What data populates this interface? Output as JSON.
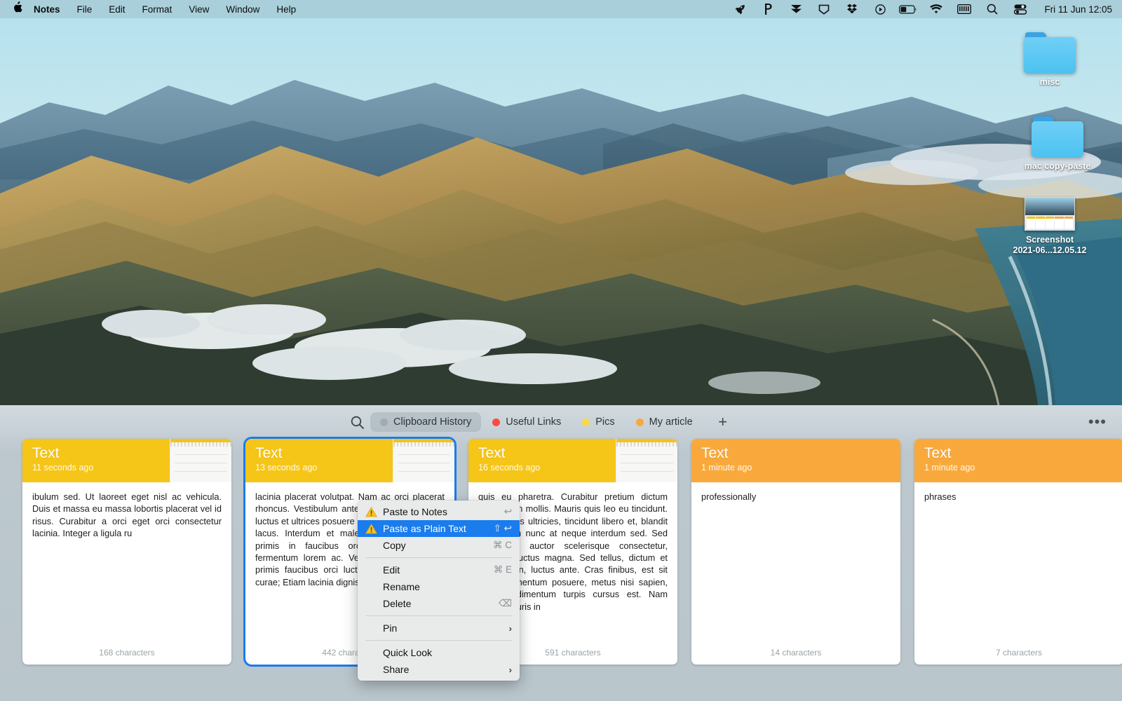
{
  "menubar": {
    "apple_glyph": "&#63743;",
    "items": [
      {
        "label": "Notes",
        "bold": true
      },
      {
        "label": "File",
        "bold": false
      },
      {
        "label": "Edit",
        "bold": false
      },
      {
        "label": "Format",
        "bold": false
      },
      {
        "label": "View",
        "bold": false
      },
      {
        "label": "Window",
        "bold": false
      },
      {
        "label": "Help",
        "bold": false
      }
    ],
    "status_icons": [
      {
        "name": "rocket-icon",
        "glyph": "Ὠ0"
      },
      {
        "name": "pocket-icon",
        "glyph": "P"
      },
      {
        "name": "chevron-stack-icon",
        "glyph": "⮟"
      },
      {
        "name": "tag-icon",
        "glyph": "⬟"
      },
      {
        "name": "dropbox-icon",
        "glyph": "❖"
      },
      {
        "name": "play-circle-icon",
        "glyph": "▶"
      },
      {
        "name": "battery-icon",
        "glyph": "battery"
      },
      {
        "name": "wifi-icon",
        "glyph": "◠"
      },
      {
        "name": "keyboard-icon",
        "glyph": "⌸"
      },
      {
        "name": "spotlight-search-icon",
        "glyph": "⚲"
      },
      {
        "name": "control-center-icon",
        "glyph": "⌸"
      }
    ],
    "clock": "Fri 11 Jun  12:05"
  },
  "desktop": {
    "icons": [
      {
        "name": "folder-misc",
        "label": "misc",
        "type": "folder"
      },
      {
        "name": "folder-mac-copy-paste",
        "label": "mac copy-paste",
        "type": "folder"
      },
      {
        "name": "file-screenshot",
        "label_line1": "Screenshot",
        "label_line2": "2021-06...12.05.12",
        "type": "image"
      }
    ]
  },
  "panel": {
    "toolbar": {
      "search_icon": "search-icon",
      "add_label": "+",
      "more_label": "•••",
      "tabs": [
        {
          "label": "Clipboard History",
          "color": "#a4abb0",
          "active": true
        },
        {
          "label": "Useful Links",
          "color": "#fa4b42",
          "active": false
        },
        {
          "label": "Pics",
          "color": "#f7d948",
          "active": false
        },
        {
          "label": "My article",
          "color": "#f9a93c",
          "active": false
        }
      ]
    },
    "cards": [
      {
        "title": "Text",
        "time": "11 seconds ago",
        "header_color": "#f5c518",
        "has_thumbnail": true,
        "body": "ibulum sed. Ut laoreet eget nisl ac vehicula. Duis et massa eu massa lobortis placerat vel id risus. Curabitur a orci eget orci consectetur lacinia. Integer a ligula ru",
        "footer": "168 characters",
        "selected": false
      },
      {
        "title": "Text",
        "time": "13 seconds ago",
        "header_color": "#f5c518",
        "has_thumbnail": true,
        "body": " lacinia placerat volutpat. Nam ac orci placerat rhoncus. Vestibulum ante ipsum primis in orci luctus et ultrices posuere curae; Donec sit amet lacus. Interdum et malesuada fames ipsum primis in faucibus orci egestas leo, et fermentum lorem ac. Vestibulum ante ipsum primis faucibus orci luctus et ultrices cubilia curae; Etiam lacinia dignissim ame",
        "footer": "442 characters",
        "selected": true
      },
      {
        "title": "Text",
        "time": "16 seconds ago",
        "header_color": "#f5c518",
        "has_thumbnail": true,
        "body": "quis eu pharetra. Curabitur pretium dictum elementum mollis. Mauris quis leo eu tincidunt. Ut faucibus ultricies, tincidunt libero et, blandit aliquam in nunc at neque interdum sed. Sed est arcu, auctor scelerisque consectetur, vehicula luctus magna. Sed tellus, dictum et molestie in, luctus ante. Cras finibus, est sit amet elementum posuere, metus nisi sapien, quis condimentum turpis cursus est. Nam luctus mauris in",
        "footer": "591 characters",
        "selected": false
      },
      {
        "title": "Text",
        "time": "1 minute ago",
        "header_color": "#f9a93c",
        "has_thumbnail": false,
        "body": "professionally",
        "footer": "14 characters",
        "selected": false
      },
      {
        "title": "Text",
        "time": "1 minute ago",
        "header_color": "#f9a93c",
        "has_thumbnail": false,
        "body": "phrases",
        "footer": "7 characters",
        "selected": false
      }
    ]
  },
  "context_menu": {
    "items": [
      {
        "label": "Paste to Notes",
        "shortcut": "↩",
        "warn": true,
        "highlight": false,
        "arrow": false
      },
      {
        "label": "Paste as Plain Text",
        "shortcut": "⇧ ↩",
        "warn": true,
        "highlight": true,
        "arrow": false
      },
      {
        "label": "Copy",
        "shortcut": "⌘ C",
        "warn": false,
        "highlight": false,
        "arrow": false
      },
      {
        "separator": true
      },
      {
        "label": "Edit",
        "shortcut": "⌘ E",
        "warn": false,
        "highlight": false,
        "arrow": false
      },
      {
        "label": "Rename",
        "shortcut": "",
        "warn": false,
        "highlight": false,
        "arrow": false
      },
      {
        "label": "Delete",
        "shortcut": "⌫",
        "warn": false,
        "highlight": false,
        "arrow": false
      },
      {
        "separator": true
      },
      {
        "label": "Pin",
        "shortcut": "",
        "warn": false,
        "highlight": false,
        "arrow": true
      },
      {
        "separator": true
      },
      {
        "label": "Quick Look",
        "shortcut": "",
        "warn": false,
        "highlight": false,
        "arrow": false
      },
      {
        "label": "Share",
        "shortcut": "",
        "warn": false,
        "highlight": false,
        "arrow": true
      }
    ]
  },
  "colors": {
    "accent_blue": "#1a7ced",
    "yellow_header": "#f5c518",
    "orange_header": "#f9a93c",
    "panel_bg": "#b9c6cc"
  }
}
